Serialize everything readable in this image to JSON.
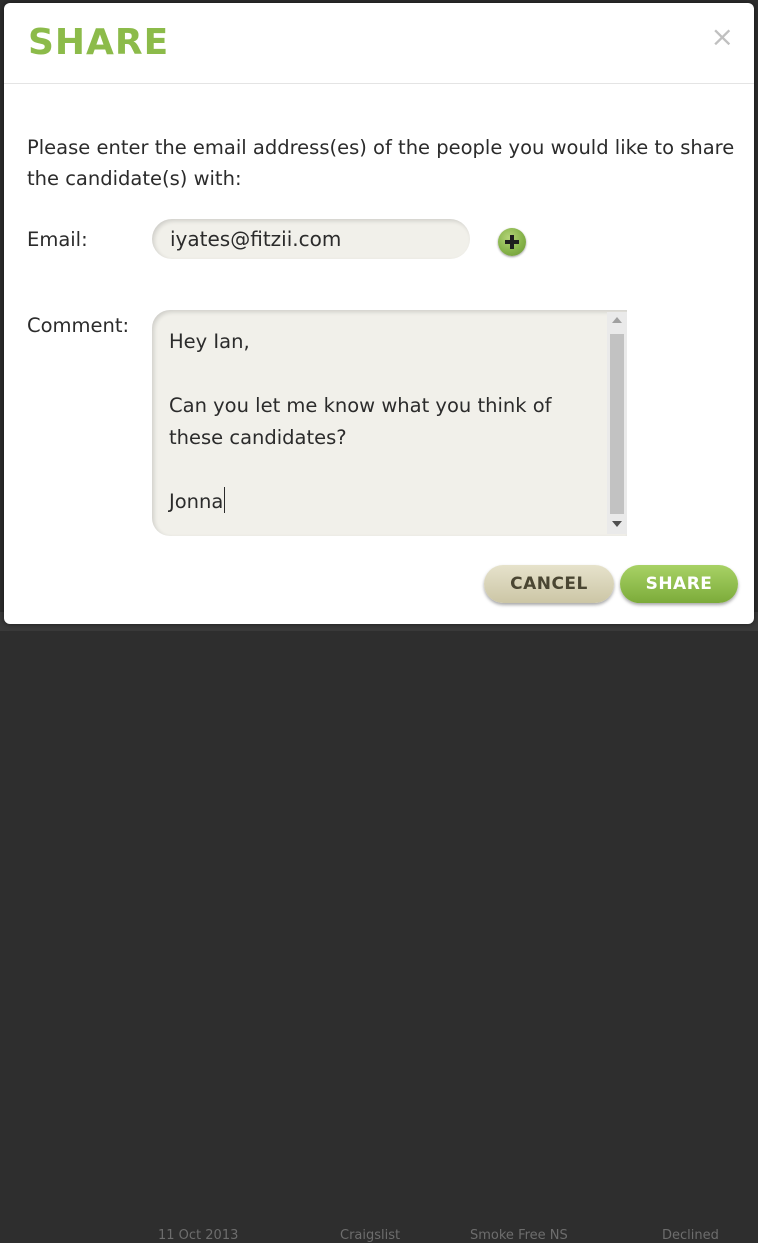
{
  "background": {
    "fragments": [
      "11 Oct 2013",
      "Craigslist",
      "Smoke Free NS",
      "Declined"
    ]
  },
  "modal": {
    "title": "SHARE",
    "close_glyph": "×",
    "intro": "Please enter the email address(es) of the people you would like to share the candidate(s) with:",
    "email": {
      "label": "Email:",
      "value": "iyates@fitzii.com"
    },
    "add_email_icon": "plus-circle-icon",
    "comment": {
      "label": "Comment:",
      "value": "Hey Ian,\n\nCan you let me know what you think of these candidates?\n\nJonna"
    },
    "buttons": {
      "cancel": "CANCEL",
      "share": "SHARE"
    }
  },
  "colors": {
    "accent": "#8cbb4a",
    "cancel_bg": "#d9d4b8",
    "share_bg": "#8cbb4a"
  }
}
